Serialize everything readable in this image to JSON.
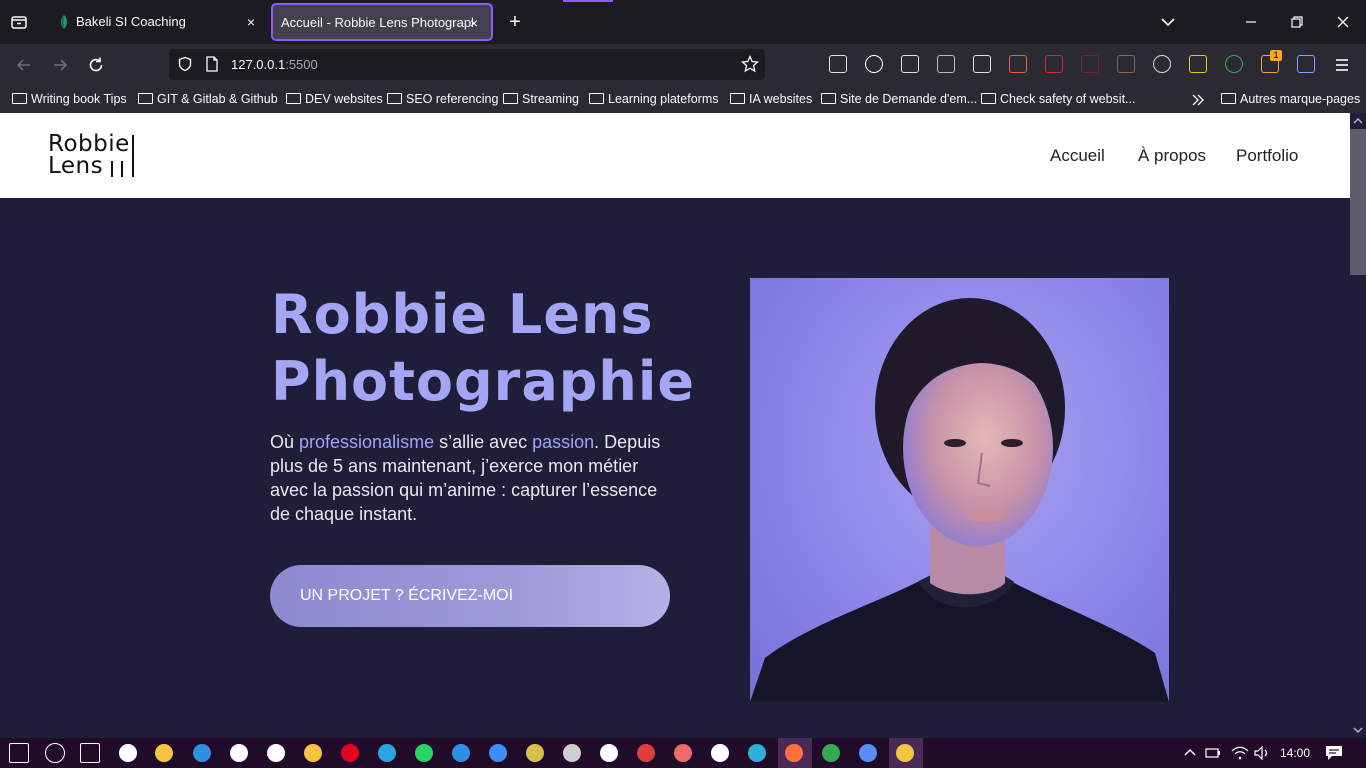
{
  "browser": {
    "tabs": [
      {
        "title": "Bakeli SI Coaching",
        "active": false
      },
      {
        "title": "Accueil - Robbie Lens Photographie",
        "active": true
      }
    ],
    "close_glyph": "×",
    "new_tab_glyph": "+",
    "url": {
      "host": "127.0.0.1",
      "port": ":5500"
    },
    "bookmarks": [
      "Writing book Tips",
      "GIT & Gitlab & Github",
      "DEV websites",
      "SEO referencing",
      "Streaming",
      "Learning plateforms",
      "IA websites",
      "Site de Demande d'em...",
      "Check safety of websit...",
      "Autres marque-pages"
    ],
    "extensions": [
      {
        "name": "pocket-icon",
        "color": "#e0e0e6"
      },
      {
        "name": "m-extension-icon",
        "color": "#ffffff"
      },
      {
        "name": "puzzle-icon",
        "color": "#e0e0e6"
      },
      {
        "name": "owl-extension-icon",
        "color": "#c9b8a0"
      },
      {
        "name": "translate-icon",
        "color": "#e0e0e6"
      },
      {
        "name": "flag-extension-icon",
        "color": "#e8603c"
      },
      {
        "name": "hd-extension-icon",
        "color": "#d22a2a"
      },
      {
        "name": "ublock-icon",
        "color": "#8a1c1c"
      },
      {
        "name": "hand-extension-icon",
        "color": "#8b6a4a"
      },
      {
        "name": "dark-reader-icon",
        "color": "#d7d7d7"
      },
      {
        "name": "ps-extension-icon",
        "color": "#f0c419"
      },
      {
        "name": "refresh-extension-icon",
        "color": "#3ba55c"
      },
      {
        "name": "sneaker-extension-icon",
        "color": "#f2a33a"
      },
      {
        "name": "reader-extension-icon",
        "color": "#7aa7ff"
      }
    ],
    "extension_badge": "1"
  },
  "site": {
    "logo": {
      "line1": "Robbie",
      "line2": "Lens"
    },
    "nav": [
      "Accueil",
      "À propos",
      "Portfolio"
    ],
    "hero": {
      "title_line1": "Robbie Lens",
      "title_line2": "Photographie",
      "text_prefix": "Où ",
      "text_highlight1": "professionalisme",
      "text_mid": " s’allie avec ",
      "text_highlight2": "passion",
      "text_rest": ". Depuis plus de 5 ans maintenant, j’exerce mon métier avec la passion qui m’anime : capturer l’essence de chaque instant.",
      "cta": "UN PROJET ? ÉCRIVEZ-MOI"
    },
    "colors": {
      "bg": "#1f1e39",
      "accent": "#a3a6f5",
      "highlight": "#9ea3ff"
    }
  },
  "taskbar": {
    "apps": [
      {
        "name": "windows-start-icon",
        "color": "#ffffff"
      },
      {
        "name": "search-icon",
        "color": "#ffffff"
      },
      {
        "name": "task-view-icon",
        "color": "#ffffff"
      },
      {
        "name": "app-circle-icon",
        "color": "#ffffff"
      },
      {
        "name": "file-explorer-icon",
        "color": "#f5c542"
      },
      {
        "name": "mail-icon",
        "color": "#2f8fe0"
      },
      {
        "name": "x-icon",
        "color": "#ffffff"
      },
      {
        "name": "medium-icon",
        "color": "#ffffff"
      },
      {
        "name": "sticky-notes-icon",
        "color": "#f5c542"
      },
      {
        "name": "pinterest-icon",
        "color": "#e60023"
      },
      {
        "name": "telegram-icon",
        "color": "#2aa5e0"
      },
      {
        "name": "whatsapp-icon",
        "color": "#25d366"
      },
      {
        "name": "vscode-icon",
        "color": "#2f8fe0"
      },
      {
        "name": "todo-icon",
        "color": "#3e8ef7"
      },
      {
        "name": "git-kraken-icon",
        "color": "#d8c04a"
      },
      {
        "name": "settings-icon",
        "color": "#cfcfcf"
      },
      {
        "name": "github-icon",
        "color": "#ffffff"
      },
      {
        "name": "star-of-david-icon",
        "color": "#e23b3b"
      },
      {
        "name": "colorful-app-icon",
        "color": "#ef6b6b"
      },
      {
        "name": "notion-icon",
        "color": "#ffffff"
      },
      {
        "name": "edge-icon",
        "color": "#2fb0d8"
      },
      {
        "name": "firefox-icon",
        "color": "#ff7139"
      },
      {
        "name": "chrome-icon",
        "color": "#34a853"
      },
      {
        "name": "chat-icon",
        "color": "#5b8cf7"
      },
      {
        "name": "clapper-icon",
        "color": "#f5c542"
      }
    ],
    "time": "14:00"
  }
}
